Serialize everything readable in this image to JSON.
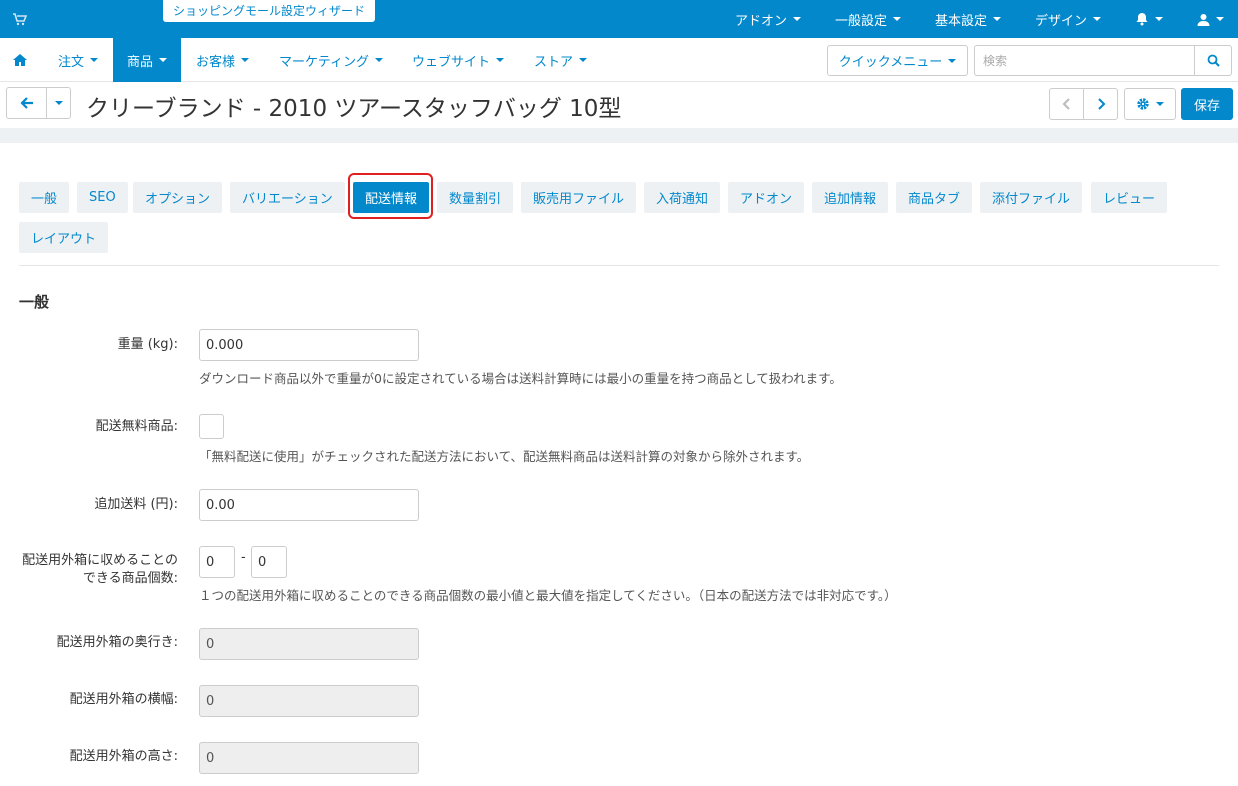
{
  "topbar": {
    "wizard_label": "ショッピングモール設定ウィザード",
    "menu": [
      "アドオン",
      "一般設定",
      "基本設定",
      "デザイン"
    ]
  },
  "nav": {
    "items": [
      "注文",
      "商品",
      "お客様",
      "マーケティング",
      "ウェブサイト",
      "ストア"
    ],
    "active": "商品",
    "quick_menu": "クイックメニュー",
    "search_placeholder": "検索"
  },
  "title": {
    "text": "クリーブランド - 2010 ツアースタッフバッグ 10型",
    "save_label": "保存"
  },
  "tabs": {
    "items": [
      "一般",
      "SEO",
      "オプション",
      "バリエーション",
      "配送情報",
      "数量割引",
      "販売用ファイル",
      "入荷通知",
      "アドオン",
      "追加情報",
      "商品タブ",
      "添付ファイル",
      "レビュー",
      "レイアウト"
    ],
    "active": "配送情報"
  },
  "section_title": "一般",
  "form": {
    "weight": {
      "label": "重量 (kg):",
      "value": "0.000",
      "help": "ダウンロード商品以外で重量が0に設定されている場合は送料計算時には最小の重量を持つ商品として扱われます。"
    },
    "free_shipping": {
      "label": "配送無料商品:",
      "checked": false,
      "help": "「無料配送に使用」がチェックされた配送方法において、配送無料商品は送料計算の対象から除外されます。"
    },
    "extra_shipping": {
      "label": "追加送料 (円):",
      "value": "0.00"
    },
    "box_items": {
      "label_line1": "配送用外箱に収めることの",
      "label_line2": "できる商品個数:",
      "min": "0",
      "separator": "-",
      "max": "0",
      "help": "１つの配送用外箱に収めることのできる商品個数の最小値と最大値を指定してください。（日本の配送方法では非対応です。）"
    },
    "box_depth": {
      "label": "配送用外箱の奥行き:",
      "value": "0"
    },
    "box_width": {
      "label": "配送用外箱の横幅:",
      "value": "0"
    },
    "box_height": {
      "label": "配送用外箱の高さ:",
      "value": "0"
    }
  },
  "colors": {
    "accent": "#0388cc",
    "highlight": "#e02020"
  }
}
